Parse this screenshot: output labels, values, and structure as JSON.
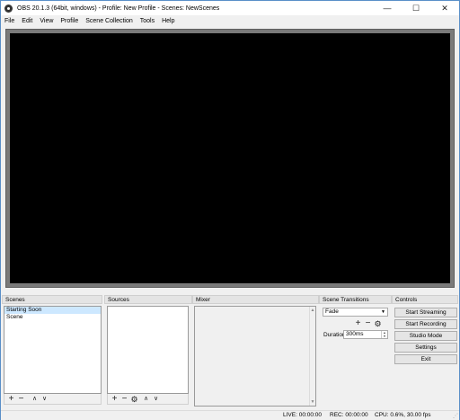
{
  "window": {
    "title": "OBS 20.1.3 (64bit, windows) - Profile: New Profile - Scenes: NewScenes",
    "minimize": "—",
    "maximize": "☐",
    "close": "✕"
  },
  "menu": [
    "File",
    "Edit",
    "View",
    "Profile",
    "Scene Collection",
    "Tools",
    "Help"
  ],
  "docks": {
    "scenes": {
      "title": "Scenes",
      "items": [
        {
          "label": "Starting Soon",
          "selected": true
        },
        {
          "label": "Scene",
          "selected": false
        }
      ]
    },
    "sources": {
      "title": "Sources",
      "items": []
    },
    "mixer": {
      "title": "Mixer"
    },
    "transitions": {
      "title": "Scene Transitions",
      "selected": "Fade",
      "duration_label": "Duration",
      "duration_value": "300ms"
    },
    "controls": {
      "title": "Controls",
      "buttons": [
        "Start Streaming",
        "Start Recording",
        "Studio Mode",
        "Settings",
        "Exit"
      ]
    }
  },
  "icons": {
    "add": "+",
    "remove": "−",
    "up": "∧",
    "down": "∨",
    "gear": "⚙",
    "dropdown": "▼",
    "spin_up": "▲",
    "spin_down": "▼",
    "scroll_up": "▲",
    "scroll_down": "▼",
    "grip": "⋰"
  },
  "status": {
    "live": "LIVE: 00:00:00",
    "rec": "REC: 00:00:00",
    "cpu": "CPU: 0.6%, 30.00 fps"
  }
}
